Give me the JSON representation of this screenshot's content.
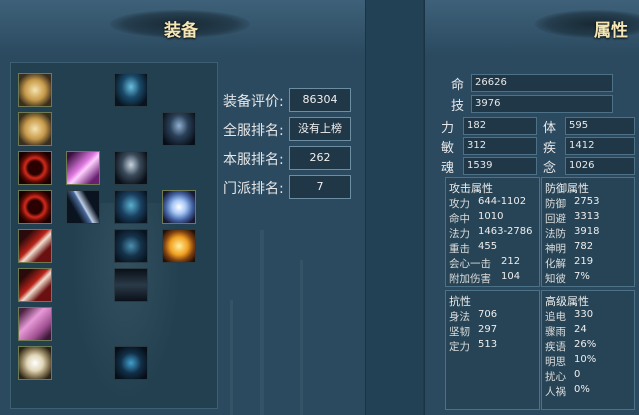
{
  "equipment": {
    "title": "装备",
    "rankings": [
      {
        "label": "装备评价:",
        "value": "86304"
      },
      {
        "label": "全服排名:",
        "value": "没有上榜"
      },
      {
        "label": "本服排名:",
        "value": "262"
      },
      {
        "label": "门派排名:",
        "value": "7"
      }
    ]
  },
  "attributes": {
    "title": "属性",
    "ming": {
      "label": "命",
      "value": "26626"
    },
    "ji": {
      "label": "技",
      "value": "3976"
    },
    "stats": [
      {
        "label": "力",
        "value": "182"
      },
      {
        "label": "体",
        "value": "595"
      },
      {
        "label": "敏",
        "value": "312"
      },
      {
        "label": "疾",
        "value": "1412"
      },
      {
        "label": "魂",
        "value": "1539"
      },
      {
        "label": "念",
        "value": "1026"
      }
    ],
    "attack": {
      "title": "攻击属性",
      "rows": [
        {
          "label": "攻力",
          "value": "644-1102"
        },
        {
          "label": "命中",
          "value": "1010"
        },
        {
          "label": "法力",
          "value": "1463-2786"
        },
        {
          "label": "重击",
          "value": "455"
        },
        {
          "label": "会心一击",
          "value": "212"
        },
        {
          "label": "附加伤害",
          "value": "104"
        }
      ]
    },
    "defense": {
      "title": "防御属性",
      "rows": [
        {
          "label": "防御",
          "value": "2753"
        },
        {
          "label": "回避",
          "value": "3313"
        },
        {
          "label": "法防",
          "value": "3918"
        },
        {
          "label": "神明",
          "value": "782"
        },
        {
          "label": "化解",
          "value": "219"
        },
        {
          "label": "知彼",
          "value": "7%"
        }
      ]
    },
    "resist": {
      "title": "抗性",
      "rows": [
        {
          "label": "身法",
          "value": "706"
        },
        {
          "label": "坚韧",
          "value": "297"
        },
        {
          "label": "定力",
          "value": "513"
        }
      ]
    },
    "advanced": {
      "title": "高级属性",
      "rows": [
        {
          "label": "追电",
          "value": "330"
        },
        {
          "label": "骤雨",
          "value": "24"
        },
        {
          "label": "疾语",
          "value": "26%"
        },
        {
          "label": "明思",
          "value": "10%"
        },
        {
          "label": "扰心",
          "value": "0"
        },
        {
          "label": "人祸",
          "value": "0%"
        }
      ]
    }
  },
  "icons": [
    "star-flower-icon",
    "star-flower-icon",
    "red-ring-icon",
    "red-ring-icon",
    "claw-weapon-icon",
    "claw-weapon-icon",
    "pink-feather-icon",
    "moon-pendant-icon",
    "pink-crystal-icon",
    "blade-weapon-icon",
    "hood-helm-icon",
    "shoulder-armor-icon",
    "chest-armor-icon",
    "wing-armor-icon",
    "glove-icon",
    "pants-icon",
    "boots-icon",
    "blue-orb-icon",
    "golden-burst-icon"
  ]
}
